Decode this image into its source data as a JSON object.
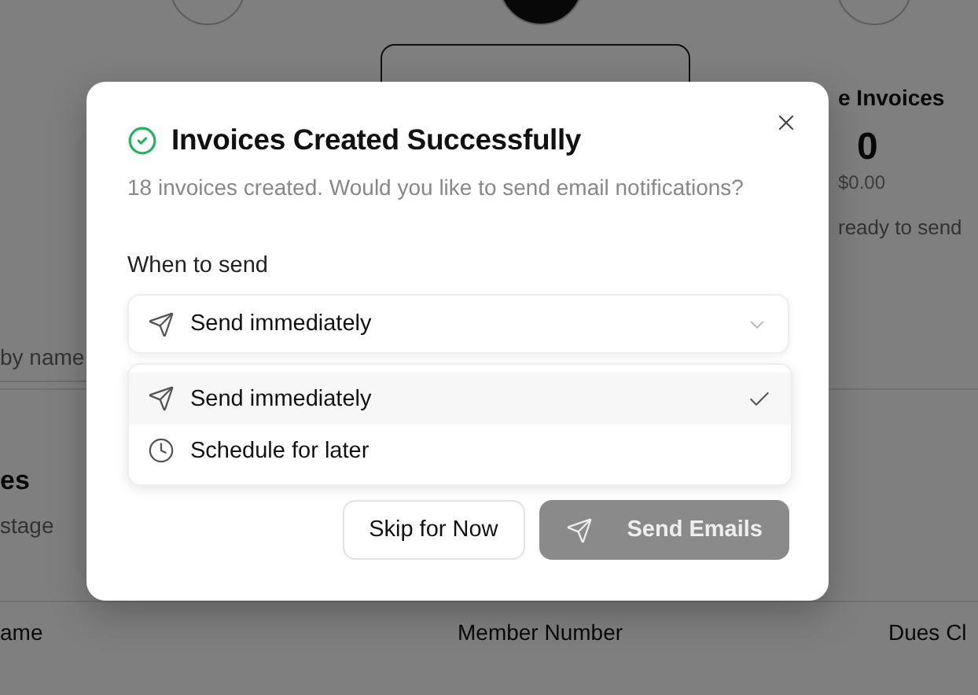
{
  "background": {
    "stat_title": "e Invoices",
    "stat_value": "0",
    "stat_amount": "$0.00",
    "stat_caption": "ready to send",
    "search_placeholder": "by name",
    "section_title": "es",
    "section_subtitle": "stage",
    "table": {
      "columns": [
        "ame",
        "Member Number",
        "Dues Cl"
      ]
    }
  },
  "dialog": {
    "title": "Invoices Created Successfully",
    "message": "18 invoices created. Would you like to send email notifications?",
    "field_label": "When to send",
    "select": {
      "value": "Send immediately",
      "kind": "immediate",
      "expanded": true
    },
    "options": [
      {
        "label": "Send immediately",
        "kind": "immediate",
        "selected": true
      },
      {
        "label": "Schedule for later",
        "kind": "scheduled",
        "selected": false
      }
    ],
    "buttons": [
      {
        "label": "Skip for Now",
        "kind": "secondary",
        "disabled": false
      },
      {
        "label": "Send Emails",
        "kind": "primary",
        "disabled": true
      }
    ]
  }
}
